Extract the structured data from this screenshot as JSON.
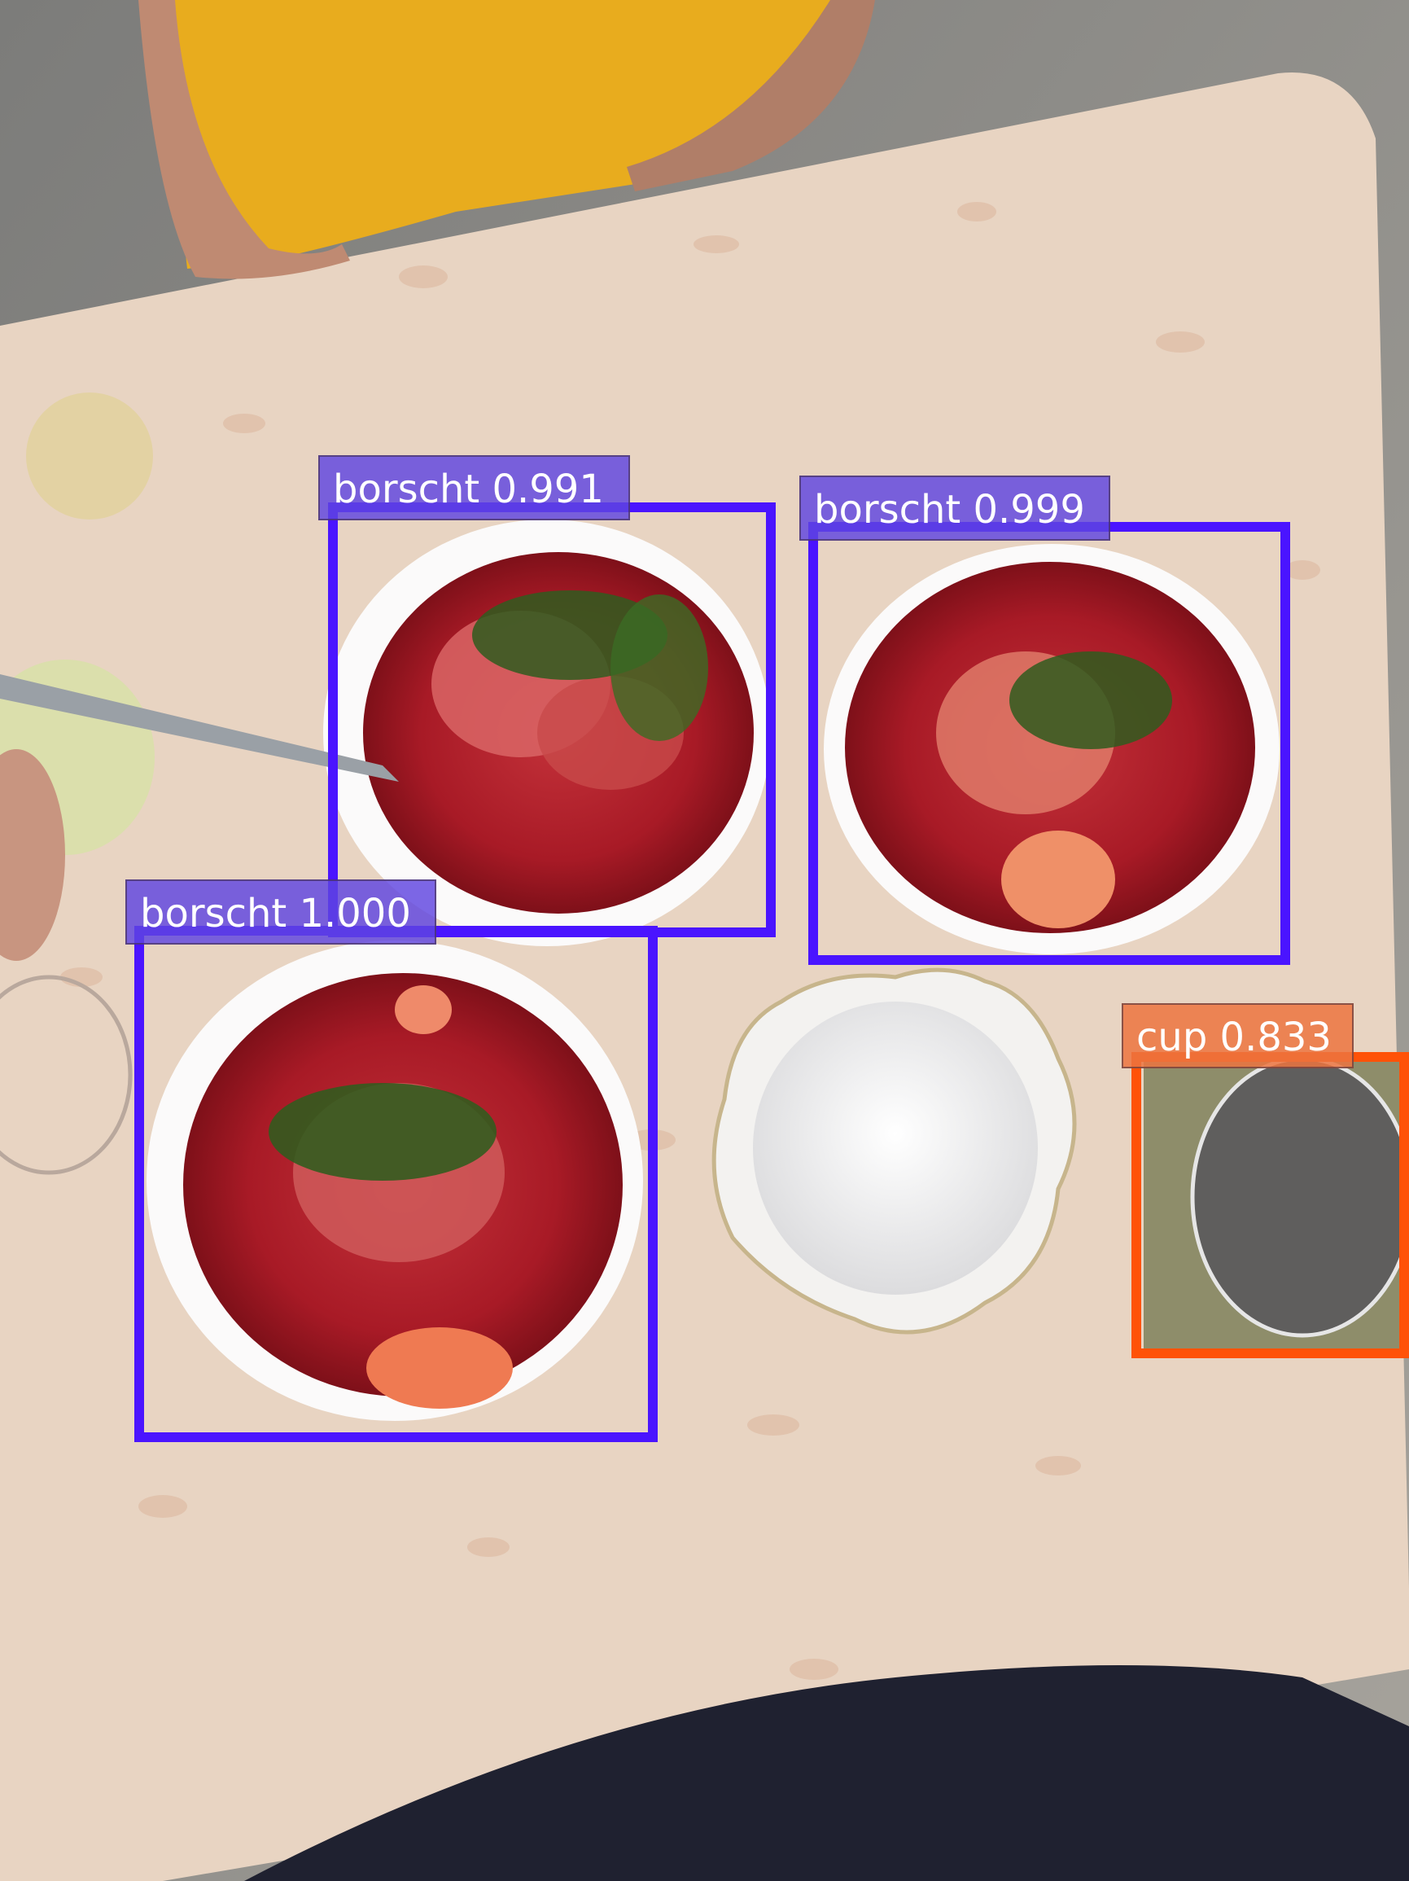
{
  "detections": [
    {
      "label": "borscht 0.991",
      "color": "#4a14ff",
      "label_bg": "rgba(95,70,225,0.82)"
    },
    {
      "label": "borscht 0.999",
      "color": "#4a14ff",
      "label_bg": "rgba(95,70,225,0.82)"
    },
    {
      "label": "borscht 1.000",
      "color": "#4a14ff",
      "label_bg": "rgba(95,70,225,0.82)"
    },
    {
      "label": "cup 0.833",
      "color": "#ff5208",
      "label_bg": "rgba(236,116,64,0.85)"
    }
  ],
  "scene_colors": {
    "table": "#e8d4c2",
    "shirt": "#e8ac1e",
    "soup": "#a81a26",
    "bowl": "#fbfafa",
    "dark_cloth": "#1f2130"
  }
}
